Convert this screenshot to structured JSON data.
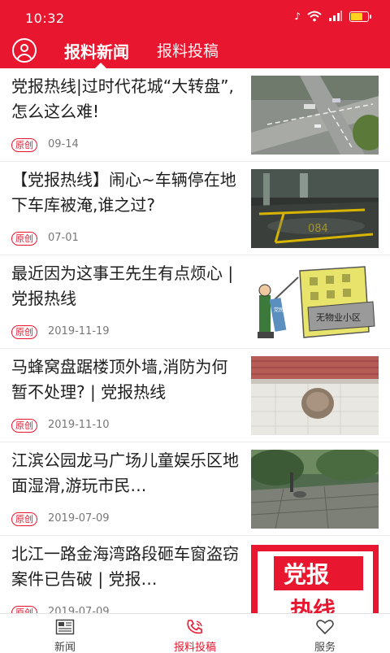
{
  "status_bar": {
    "time": "10:32"
  },
  "header": {
    "tabs": [
      {
        "label": "报料新闻",
        "active": true
      },
      {
        "label": "报料投稿",
        "active": false
      }
    ],
    "accent_color": "#e8172f"
  },
  "news": [
    {
      "title": "党报热线|过时代花城“大转盘”,怎么这么难!",
      "badge": "原创",
      "date": "09-14",
      "thumb": "road-intersection"
    },
    {
      "title": "【党报热线】闹心~车辆停在地下车库被淹,谁之过?",
      "badge": "原创",
      "date": "07-01",
      "thumb": "flooded-garage"
    },
    {
      "title": "最近因为这事王先生有点烦心 | 党报热线",
      "badge": "原创",
      "date": "2019-11-19",
      "thumb": "cartoon-building"
    },
    {
      "title": "马蜂窝盘踞楼顶外墙,消防为何暂不处理? | 党报热线",
      "badge": "原创",
      "date": "2019-11-10",
      "thumb": "hornet-nest"
    },
    {
      "title": "江滨公园龙马广场儿童娱乐区地面湿滑,游玩市民…",
      "badge": "原创",
      "date": "2019-07-09",
      "thumb": "park-plaza"
    },
    {
      "title": "北江一路金海湾路段砸车窗盗窃案件已告破 | 党报…",
      "badge": "原创",
      "date": "2019-07-09",
      "thumb": "hotline-logo"
    }
  ],
  "thumb_texts": {
    "cartoon_sign": "无物业小区",
    "cartoon_banner": "党民热线",
    "garage_number": "084",
    "logo_line1": "党报",
    "logo_line2": "热线"
  },
  "bottom_nav": [
    {
      "label": "新闻",
      "icon": "newspaper-icon",
      "active": false
    },
    {
      "label": "报料投稿",
      "icon": "phone-hotline-icon",
      "active": true
    },
    {
      "label": "服务",
      "icon": "heart-icon",
      "active": false
    }
  ]
}
